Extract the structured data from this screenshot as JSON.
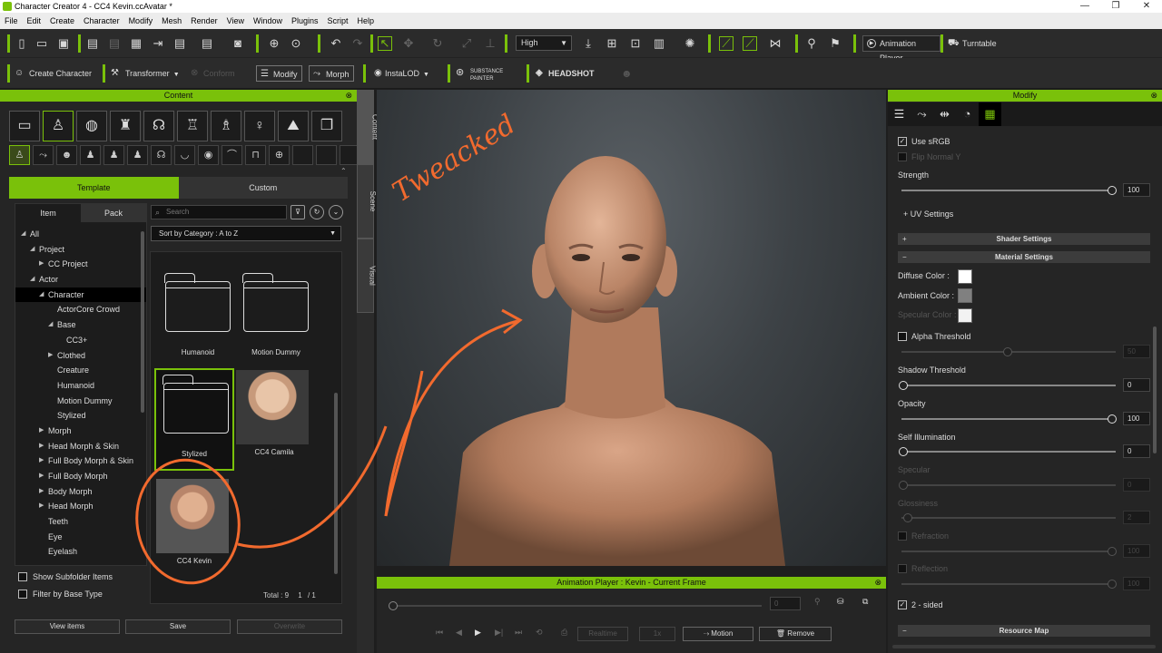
{
  "window": {
    "title": "Character Creator 4 - CC4 Kevin.ccAvatar *",
    "buttons": [
      "—",
      "❐",
      "✕"
    ]
  },
  "menu": [
    "File",
    "Edit",
    "Create",
    "Character",
    "Modify",
    "Mesh",
    "Render",
    "View",
    "Window",
    "Plugins",
    "Script",
    "Help"
  ],
  "toolbar": {
    "quality": "High",
    "animation_player": "Animation Player",
    "turntable": "Turntable"
  },
  "toolbar2": {
    "create_character": "Create Character",
    "transformer": "Transformer",
    "conform": "Conform",
    "modify": "Modify",
    "morph": "Morph",
    "instalod": "InstaLOD",
    "substance_painter": "SUBSTANCE PAINTER",
    "headshot": "HEADSHOT"
  },
  "content_panel": {
    "title": "Content",
    "tabs": [
      "Template",
      "Custom"
    ],
    "sub_tabs": [
      "Item",
      "Pack"
    ],
    "search_placeholder": "Search",
    "sort": "Sort by Category : A to Z",
    "tree": [
      {
        "label": "All",
        "indent": 0,
        "exp": "◢"
      },
      {
        "label": "Project",
        "indent": 1,
        "exp": "◢"
      },
      {
        "label": "CC Project",
        "indent": 2,
        "exp": "▶"
      },
      {
        "label": "Actor",
        "indent": 1,
        "exp": "◢"
      },
      {
        "label": "Character",
        "indent": 2,
        "exp": "◢",
        "selected": true
      },
      {
        "label": "ActorCore Crowd",
        "indent": 3
      },
      {
        "label": "Base",
        "indent": 3,
        "exp": "◢"
      },
      {
        "label": "CC3+",
        "indent": 4
      },
      {
        "label": "Clothed",
        "indent": 3,
        "exp": "▶"
      },
      {
        "label": "Creature",
        "indent": 3
      },
      {
        "label": "Humanoid",
        "indent": 3
      },
      {
        "label": "Motion Dummy",
        "indent": 3
      },
      {
        "label": "Stylized",
        "indent": 3
      },
      {
        "label": "Morph",
        "indent": 2,
        "exp": "▶"
      },
      {
        "label": "Head Morph & Skin",
        "indent": 2,
        "exp": "▶"
      },
      {
        "label": "Full Body Morph & Skin",
        "indent": 2,
        "exp": "▶"
      },
      {
        "label": "Full Body Morph",
        "indent": 2,
        "exp": "▶"
      },
      {
        "label": "Body Morph",
        "indent": 2,
        "exp": "▶"
      },
      {
        "label": "Head Morph",
        "indent": 2,
        "exp": "▶"
      },
      {
        "label": "Teeth",
        "indent": 2
      },
      {
        "label": "Eye",
        "indent": 2
      },
      {
        "label": "Eyelash",
        "indent": 2
      }
    ],
    "items": [
      "Humanoid",
      "Motion Dummy",
      "Stylized",
      "CC4 Camila",
      "CC4 Kevin"
    ],
    "show_subfolder": "Show Subfolder Items",
    "filter_base": "Filter by Base Type",
    "total": "Total : 9",
    "page": "1",
    "page_total": "/   1",
    "buttons": [
      "View items",
      "Save",
      "Overwrite"
    ]
  },
  "side_tabs": [
    "Content",
    "Scene",
    "Visual"
  ],
  "annotation": "Tweacked",
  "animation_player": {
    "title": "Animation Player : Kevin - Current Frame",
    "frame": "0",
    "realtime": "Realtime",
    "speed": "1x",
    "motion": "Motion",
    "remove": "Remove"
  },
  "modify_panel": {
    "title": "Modify",
    "use_srgb": "Use sRGB",
    "flip_normal": "Flip Normal Y",
    "strength_label": "Strength",
    "strength": "100",
    "uv_settings": "UV Settings",
    "shader_settings": "Shader Settings",
    "material_settings": "Material Settings",
    "diffuse_color": "Diffuse Color :",
    "ambient_color": "Ambient Color :",
    "specular_color": "Specular Color :",
    "alpha_threshold": "Alpha Threshold",
    "alpha_value": "50",
    "shadow_threshold": "Shadow Threshold",
    "shadow_value": "0",
    "opacity": "Opacity",
    "opacity_value": "100",
    "self_illumination": "Self Illumination",
    "self_illum_value": "0",
    "specular": "Specular",
    "specular_value": "0",
    "glossiness": "Glossiness",
    "glossiness_value": "2",
    "refraction": "Refraction",
    "refraction_value": "100",
    "reflection": "Reflection",
    "reflection_value": "100",
    "two_sided": "2 - sided",
    "resource_map": "Resource Map",
    "colors": {
      "diffuse": "#ffffff",
      "ambient": "#808080",
      "specular": "#f2f2f2"
    }
  },
  "colors": {
    "accent": "#7ac10a",
    "annotation": "#f26a2e"
  }
}
